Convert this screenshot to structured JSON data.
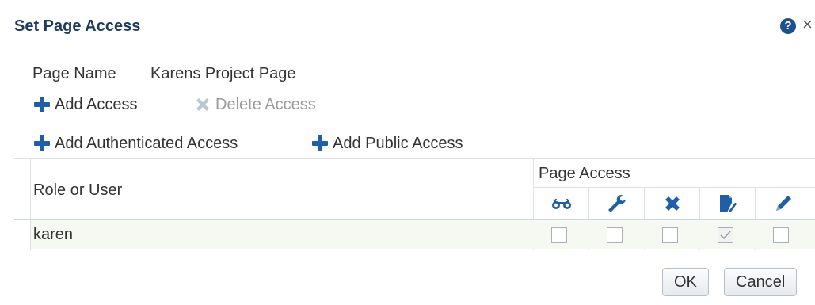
{
  "dialog": {
    "title": "Set Page Access",
    "help": "?",
    "close": "×"
  },
  "page_name": {
    "label": "Page Name",
    "value": "Karens Project Page"
  },
  "toolbar": {
    "add_access": "Add Access",
    "delete_access": "Delete Access",
    "add_authenticated_access": "Add Authenticated Access",
    "add_public_access": "Add Public Access"
  },
  "table": {
    "role_header": "Role or User",
    "page_access_header": "Page Access",
    "permission_icons": [
      "view-icon",
      "customize-icon",
      "delete-icon",
      "edit-page-icon",
      "edit-icon"
    ],
    "rows": [
      {
        "user": "karen",
        "permissions": [
          false,
          false,
          false,
          true,
          false
        ]
      }
    ]
  },
  "buttons": {
    "ok": "OK",
    "cancel": "Cancel"
  },
  "colors": {
    "title": "#1f3a5f",
    "icon_blue": "#1e5fa8",
    "disabled_icon": "#b9c7d6",
    "row_bg": "#f6f8f2"
  }
}
